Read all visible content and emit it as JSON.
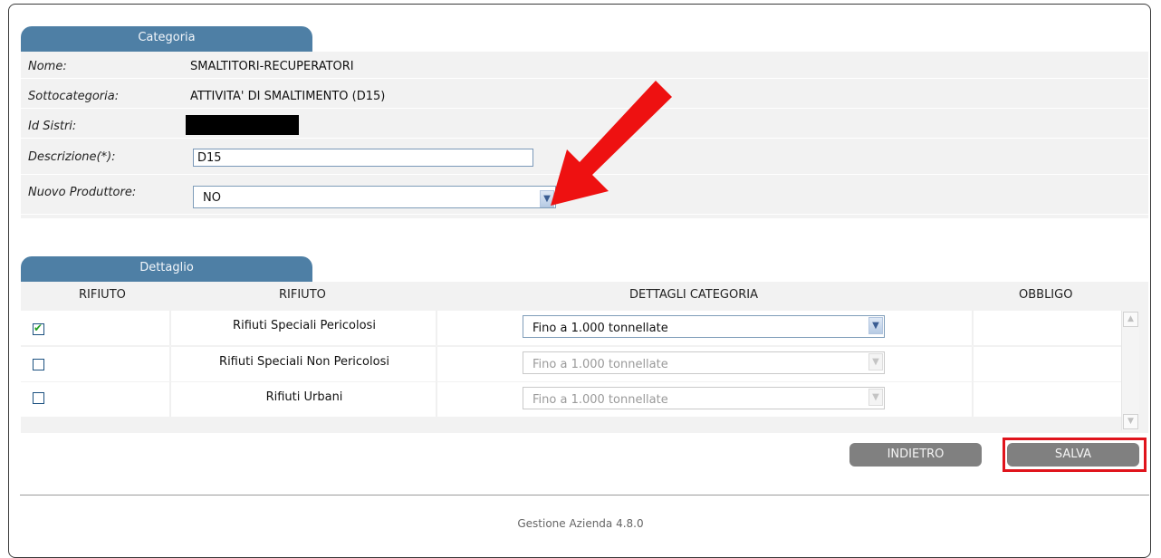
{
  "categoria": {
    "tab_label": "Categoria",
    "fields": {
      "nome_label": "Nome:",
      "nome_value": "SMALTITORI-RECUPERATORI",
      "sottocategoria_label": "Sottocategoria:",
      "sottocategoria_value": "ATTIVITA' DI SMALTIMENTO (D15)",
      "id_sistri_label": "Id Sistri:",
      "descrizione_label": "Descrizione(*):",
      "descrizione_value": "D15",
      "nuovo_produttore_label": "Nuovo Produttore:",
      "nuovo_produttore_value": "NO"
    }
  },
  "dettaglio": {
    "tab_label": "Dettaglio",
    "headers": [
      "RIFIUTO",
      "RIFIUTO",
      "DETTAGLI CATEGORIA",
      "OBBLIGO"
    ],
    "rows": [
      {
        "checked": true,
        "name": "Rifiuti Speciali Pericolosi",
        "detail": "Fino a 1.000 tonnellate",
        "enabled": true
      },
      {
        "checked": false,
        "name": "Rifiuti Speciali Non Pericolosi",
        "detail": "Fino a 1.000 tonnellate",
        "enabled": false
      },
      {
        "checked": false,
        "name": "Rifiuti Urbani",
        "detail": "Fino a 1.000 tonnellate",
        "enabled": false
      }
    ]
  },
  "actions": {
    "back_label": "INDIETRO",
    "save_label": "SALVA"
  },
  "footer": {
    "version_text": "Gestione Azienda 4.8.0"
  },
  "colors": {
    "tab": "#4e7fa5",
    "highlight": "#e0141c",
    "arrow": "#ee1111",
    "button": "#808080"
  },
  "icons": {
    "dropdown": "chevron-down-icon",
    "checkbox": "check-icon",
    "annotation": "red-arrow-icon"
  }
}
